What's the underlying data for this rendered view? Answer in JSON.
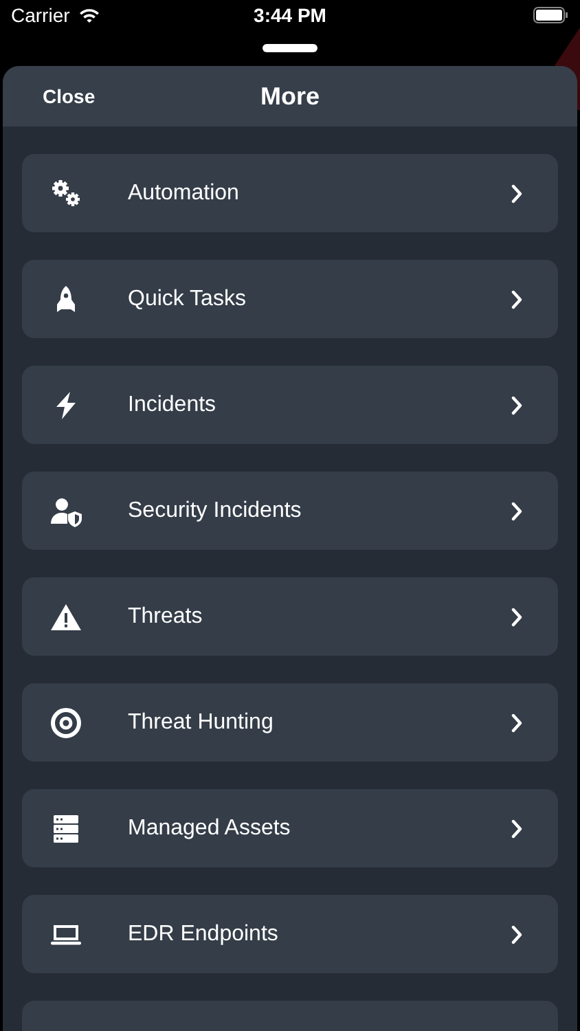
{
  "status_bar": {
    "carrier": "Carrier",
    "time": "3:44 PM"
  },
  "sheet": {
    "close": "Close",
    "title": "More"
  },
  "items": [
    {
      "label": "Automation",
      "kind": "gears"
    },
    {
      "label": "Quick Tasks",
      "kind": "rocket"
    },
    {
      "label": "Incidents",
      "kind": "bolt"
    },
    {
      "label": "Security Incidents",
      "kind": "user-shield"
    },
    {
      "label": "Threats",
      "kind": "warning"
    },
    {
      "label": "Threat Hunting",
      "kind": "target"
    },
    {
      "label": "Managed Assets",
      "kind": "server"
    },
    {
      "label": "EDR Endpoints",
      "kind": "laptop"
    }
  ]
}
